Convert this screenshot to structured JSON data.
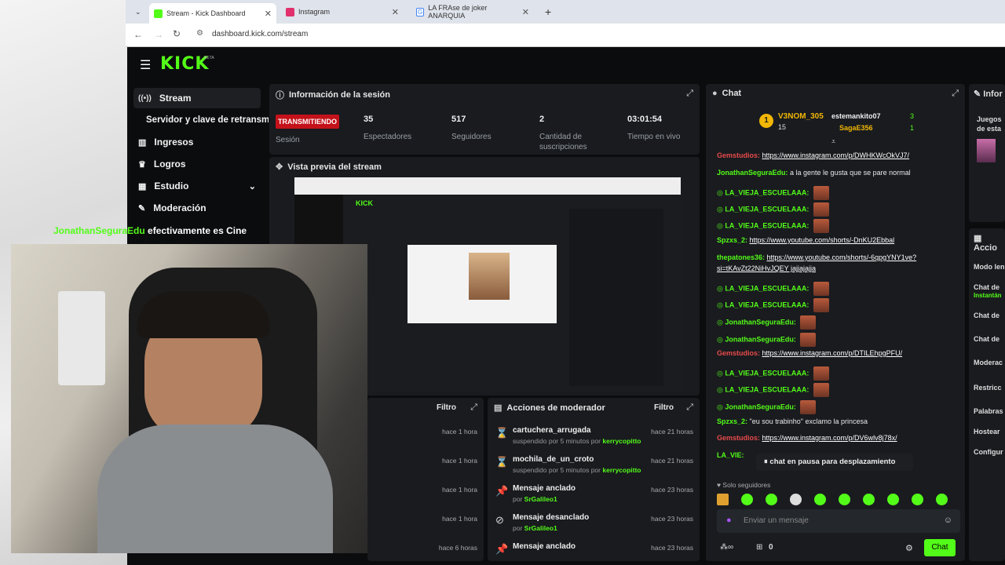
{
  "browser": {
    "tabs": [
      {
        "title": "Stream - Kick Dashboard",
        "active": true,
        "color": "#53fc18"
      },
      {
        "title": "Instagram",
        "active": false,
        "color": "#e1306c"
      },
      {
        "title": "LA FRAse de joker ANARQUIA",
        "active": false,
        "color": "#4285f4"
      }
    ],
    "url": "dashboard.kick.com/stream"
  },
  "brand": {
    "logo": "KICK",
    "beta": "BETA",
    "accent": "#53fc18"
  },
  "sidebar": {
    "items": [
      {
        "label": "Stream",
        "icon": "broadcast-icon"
      },
      {
        "label": "Servidor y clave de retransmisión",
        "icon": ""
      },
      {
        "label": "Ingresos",
        "icon": "chart-icon"
      },
      {
        "label": "Logros",
        "icon": "trophy-icon"
      },
      {
        "label": "Estudio",
        "icon": "studio-icon"
      },
      {
        "label": "Moderación",
        "icon": "wrench-icon"
      }
    ]
  },
  "overlay": {
    "username": "JonathanSeguraEdu",
    "message": "efectivamente es Cine"
  },
  "session": {
    "title": "Información de la sesión",
    "status": "TRANSMITIENDO",
    "status_label": "Sesión",
    "stats": [
      {
        "value": "35",
        "label": "Espectadores"
      },
      {
        "value": "517",
        "label": "Seguidores"
      },
      {
        "value": "2",
        "label": "Cantidad de suscripciones"
      },
      {
        "value": "03:01:54",
        "label": "Tiempo en vivo"
      }
    ]
  },
  "preview": {
    "title": "Vista previa del stream"
  },
  "left_log": {
    "filter": "Filtro",
    "rows": [
      {
        "time": "hace 1 hora"
      },
      {
        "time": "hace 1 hora"
      },
      {
        "time": "hace 1 hora"
      },
      {
        "time": "hace 1 hora"
      },
      {
        "time": "hace 6 horas"
      }
    ]
  },
  "mod_actions": {
    "title": "Acciones de moderador",
    "filter": "Filtro",
    "rows": [
      {
        "icon": "hourglass-icon",
        "title": "cartuchera_arrugada",
        "sub": "suspendido por 5 minutos por",
        "by": "kerrycopitto",
        "time": "hace 21 horas"
      },
      {
        "icon": "hourglass-icon",
        "title": "mochila_de_un_croto",
        "sub": "suspendido por 5 minutos por",
        "by": "kerrycopitto",
        "time": "hace 21 horas"
      },
      {
        "icon": "pin-icon",
        "title": "Mensaje anclado",
        "sub": "por",
        "by": "SrGalileo1",
        "time": "hace 23 horas"
      },
      {
        "icon": "unpin-icon",
        "title": "Mensaje desanclado",
        "sub": "por",
        "by": "SrGalileo1",
        "time": "hace 23 horas"
      },
      {
        "icon": "pin-icon",
        "title": "Mensaje anclado",
        "sub": "",
        "by": "",
        "time": "hace 23 horas"
      }
    ]
  },
  "chat": {
    "title": "Chat",
    "top": {
      "rank1_name": "V3NOM_305",
      "rank1_count": "15",
      "rank2_name": "estemankito07",
      "rank2_count": "3",
      "rank3_name": "SagaE356",
      "rank3_count": "1"
    },
    "messages": [
      {
        "user": "Gemstudios",
        "color": "#e84a4a",
        "text": "https://www.instagram.com/p/DWHKWcOkVJ7/",
        "link": true
      },
      {
        "user": "JonathanSeguraEdu",
        "color": "#53fc18",
        "text": "a la gente le gusta que se pare normal",
        "link": false
      },
      {
        "user": "LA_VIEJA_ESCUELAAA",
        "color": "#53fc18",
        "text": "",
        "emote": true
      },
      {
        "user": "LA_VIEJA_ESCUELAAA",
        "color": "#53fc18",
        "text": "",
        "emote": true
      },
      {
        "user": "LA_VIEJA_ESCUELAAA",
        "color": "#53fc18",
        "text": "",
        "emote": true
      },
      {
        "user": "Spzxs_2",
        "color": "#53fc18",
        "text": "https://www.youtube.com/shorts/-DnKU2Ebbal",
        "link": true
      },
      {
        "user": "thepatones36",
        "color": "#53fc18",
        "text": "https://www.youtube.com/shorts/-6qpgYNY1ve?",
        "link": true
      },
      {
        "user": "",
        "color": "#ffffff",
        "text": "si=tKAvZt22NiHvJQEY jajjajajja",
        "link": true
      },
      {
        "user": "LA_VIEJA_ESCUELAAA",
        "color": "#53fc18",
        "text": "",
        "emote": true
      },
      {
        "user": "LA_VIEJA_ESCUELAAA",
        "color": "#53fc18",
        "text": "",
        "emote": true
      },
      {
        "user": "JonathanSeguraEdu",
        "color": "#53fc18",
        "text": "",
        "emote": true
      },
      {
        "user": "JonathanSeguraEdu",
        "color": "#53fc18",
        "text": "",
        "emote": true
      },
      {
        "user": "Gemstudios",
        "color": "#e84a4a",
        "text": "https://www.instagram.com/p/DTILEhpgPFU/",
        "link": true
      },
      {
        "user": "LA_VIEJA_ESCUELAAA",
        "color": "#53fc18",
        "text": "",
        "emote": true
      },
      {
        "user": "LA_VIEJA_ESCUELAAA",
        "color": "#53fc18",
        "text": "",
        "emote": true
      },
      {
        "user": "JonathanSeguraEdu",
        "color": "#53fc18",
        "text": "",
        "emote": true
      },
      {
        "user": "Spzxs_2",
        "color": "#53fc18",
        "text": "\"eu sou trabinho\" exclamo la princesa",
        "link": false
      },
      {
        "user": "Gemstudios",
        "color": "#e84a4a",
        "text": "https://www.instagram.com/p/DV6wlv8j78x/",
        "link": true
      },
      {
        "user": "LA_VIE",
        "color": "#53fc18",
        "text": "",
        "emote": false
      }
    ],
    "paused": "chat en pausa para desplazamiento",
    "followers_only": "Solo seguidores",
    "input_placeholder": "Enviar un mensaje",
    "count": "0",
    "send_label": "Chat"
  },
  "right_panel": {
    "title1": "Infor",
    "sub1": "Juegos",
    "sub1b": "de esta",
    "title2": "Accio",
    "items": [
      "Modo len",
      "Chat de",
      "Instantán",
      "Chat de",
      "Chat de",
      "Moderac",
      "Restricc",
      "Palabras",
      "Hostear",
      "Configur"
    ]
  }
}
